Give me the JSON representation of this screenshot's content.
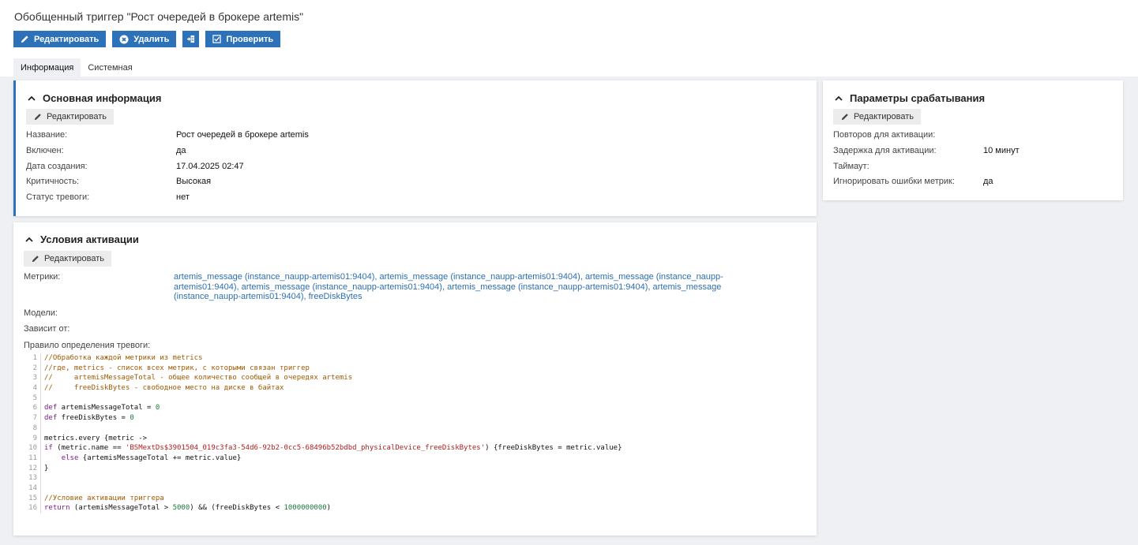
{
  "page": {
    "title": "Обобщенный триггер \"Рост очередей в брокере artemis\""
  },
  "toolbar": {
    "edit_label": "Редактировать",
    "delete_label": "Удалить",
    "check_label": "Проверить"
  },
  "tabs": [
    {
      "label": "Информация",
      "active": true
    },
    {
      "label": "Системная",
      "active": false
    }
  ],
  "main_info": {
    "title": "Основная информация",
    "edit_label": "Редактировать",
    "rows": [
      {
        "key": "Название:",
        "value": "Рост очередей в брокере artemis"
      },
      {
        "key": "Включен:",
        "value": "да"
      },
      {
        "key": "Дата создания:",
        "value": "17.04.2025 02:47"
      },
      {
        "key": "Критичность:",
        "value": "Высокая"
      },
      {
        "key": "Статус тревоги:",
        "value": "нет"
      }
    ]
  },
  "params": {
    "title": "Параметры срабатывания",
    "edit_label": "Редактировать",
    "rows": [
      {
        "key": "Повторов для активации:",
        "value": ""
      },
      {
        "key": "Задержка для активации:",
        "value": "10 минут"
      },
      {
        "key": "Таймаут:",
        "value": ""
      },
      {
        "key": "Игнорировать ошибки метрик:",
        "value": "да"
      }
    ]
  },
  "conditions": {
    "title": "Условия активации",
    "edit_label": "Редактировать",
    "metrics_label": "Метрики:",
    "metrics_lines": [
      "artemis_message (instance_naupp-artemis01:9404), artemis_message (instance_naupp-artemis01:9404), artemis_message (instance_naupp-",
      "artemis01:9404), artemis_message (instance_naupp-artemis01:9404), artemis_message (instance_naupp-artemis01:9404), artemis_message",
      "(instance_naupp-artemis01:9404), freeDiskBytes"
    ],
    "models_label": "Модели:",
    "depends_label": "Зависит от:",
    "rule_label": "Правило определения тревоги:",
    "code_lines": [
      {
        "n": "1",
        "parts": [
          {
            "t": "//Обработка каждой метрики из metrics",
            "c": "comment"
          }
        ]
      },
      {
        "n": "2",
        "parts": [
          {
            "t": "//где, metrics - список всех метрик, с которыми связан триггер",
            "c": "comment"
          }
        ]
      },
      {
        "n": "3",
        "parts": [
          {
            "t": "//     artemisMessageTotal - общее количество сообщей в очередях artemis",
            "c": "comment"
          }
        ]
      },
      {
        "n": "4",
        "parts": [
          {
            "t": "//     freeDiskBytes - свободное место на диске в байтах",
            "c": "comment"
          }
        ]
      },
      {
        "n": "5",
        "parts": []
      },
      {
        "n": "6",
        "parts": [
          {
            "t": "def",
            "c": "kw"
          },
          {
            "t": " artemisMessageTotal = ",
            "c": "plain"
          },
          {
            "t": "0",
            "c": "num"
          }
        ]
      },
      {
        "n": "7",
        "parts": [
          {
            "t": "def",
            "c": "kw"
          },
          {
            "t": " freeDiskBytes = ",
            "c": "plain"
          },
          {
            "t": "0",
            "c": "num"
          }
        ]
      },
      {
        "n": "8",
        "parts": []
      },
      {
        "n": "9",
        "parts": [
          {
            "t": "metrics.every {metric ->",
            "c": "plain"
          }
        ]
      },
      {
        "n": "10",
        "parts": [
          {
            "t": "if",
            "c": "kw"
          },
          {
            "t": " (metric.name == ",
            "c": "plain"
          },
          {
            "t": "'BSMextDs$3901504_019c3fa3-54d6-92b2-0cc5-68496b52bdbd_physicalDevice_freeDiskBytes'",
            "c": "str"
          },
          {
            "t": ") {freeDiskBytes = metric.value}",
            "c": "plain"
          }
        ]
      },
      {
        "n": "11",
        "parts": [
          {
            "t": "    ",
            "c": "plain"
          },
          {
            "t": "else",
            "c": "kw"
          },
          {
            "t": " {artemisMessageTotal += metric.value}",
            "c": "plain"
          }
        ]
      },
      {
        "n": "12",
        "parts": [
          {
            "t": "}",
            "c": "plain"
          }
        ]
      },
      {
        "n": "13",
        "parts": []
      },
      {
        "n": "14",
        "parts": []
      },
      {
        "n": "15",
        "parts": [
          {
            "t": "//Условие активации триггера",
            "c": "comment"
          }
        ]
      },
      {
        "n": "16",
        "parts": [
          {
            "t": "return",
            "c": "kw"
          },
          {
            "t": " (artemisMessageTotal > ",
            "c": "plain"
          },
          {
            "t": "5000",
            "c": "num"
          },
          {
            "t": ") && (freeDiskBytes < ",
            "c": "plain"
          },
          {
            "t": "1000000000",
            "c": "num"
          },
          {
            "t": ")",
            "c": "plain"
          }
        ]
      }
    ]
  },
  "colors": {
    "accent": "#2d72b8",
    "link": "#2d6fb0",
    "background": "#eef0f3"
  }
}
